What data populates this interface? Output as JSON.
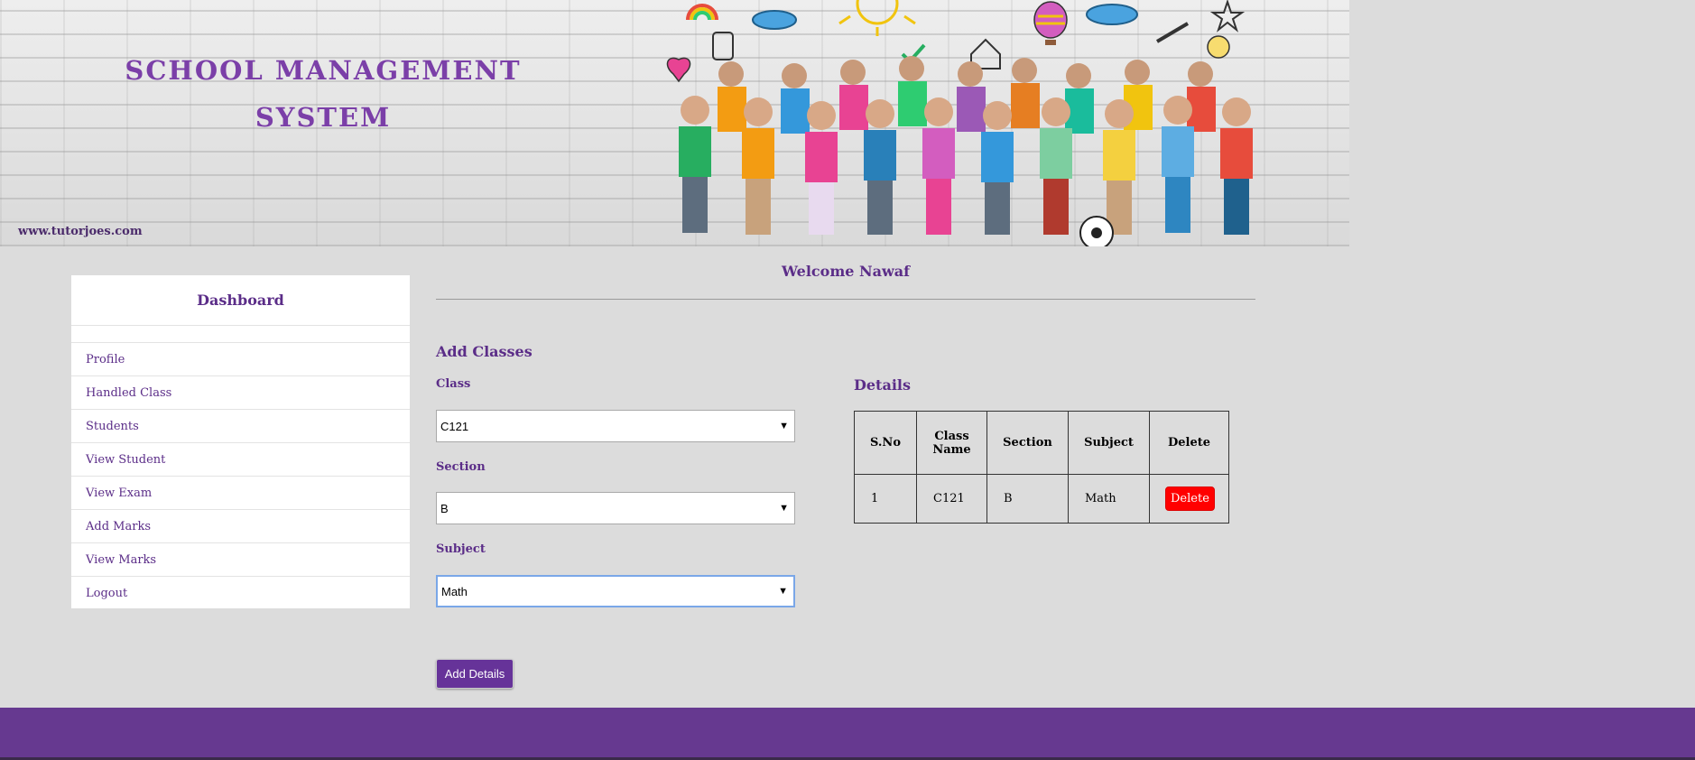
{
  "banner": {
    "title": "SCHOOL MANAGEMENT SYSTEM",
    "url": "www.tutorjoes.com"
  },
  "sidebar": {
    "heading": "Dashboard",
    "items": [
      {
        "label": "Profile"
      },
      {
        "label": "Handled Class"
      },
      {
        "label": "Students"
      },
      {
        "label": "View Student"
      },
      {
        "label": "View Exam"
      },
      {
        "label": "Add Marks"
      },
      {
        "label": "View Marks"
      },
      {
        "label": "Logout"
      }
    ]
  },
  "main": {
    "welcome": "Welcome Nawaf",
    "form_title": "Add Classes",
    "class_label": "Class",
    "class_value": "C121",
    "section_label": "Section",
    "section_value": "B",
    "subject_label": "Subject",
    "subject_value": "Math",
    "submit_label": "Add Details"
  },
  "details": {
    "title": "Details",
    "headers": [
      "S.No",
      "Class Name",
      "Section",
      "Subject",
      "Delete"
    ],
    "rows": [
      {
        "sno": "1",
        "class_name": "C121",
        "section": "B",
        "subject": "Math",
        "delete_label": "Delete"
      }
    ]
  },
  "colors": {
    "accent": "#663399",
    "delete": "#ff0000",
    "background": "#dcdcdc"
  }
}
